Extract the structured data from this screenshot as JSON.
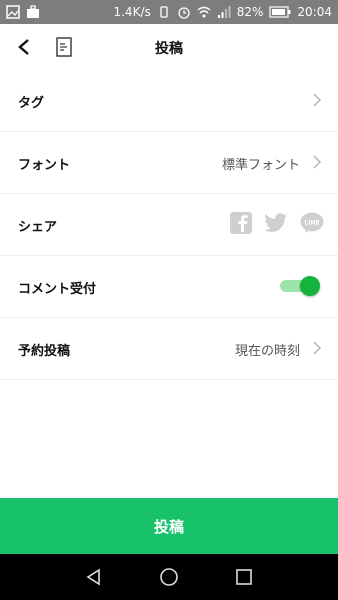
{
  "status_bar": {
    "speed": "1.4K/s",
    "battery": "82%",
    "time": "20:04"
  },
  "header": {
    "title": "投稿"
  },
  "rows": [
    {
      "label": "タグ",
      "value": ""
    },
    {
      "label": "フォント",
      "value": "標準フォント"
    },
    {
      "label": "シェア",
      "value": ""
    },
    {
      "label": "コメント受付",
      "value": ""
    },
    {
      "label": "予約投稿",
      "value": "現在の時刻"
    }
  ],
  "comment_toggle": {
    "on": true
  },
  "share_icons": [
    "facebook-icon",
    "twitter-icon",
    "line-icon"
  ],
  "bottom": {
    "post_label": "投稿"
  },
  "colors": {
    "accent_green": "#17c26b",
    "toggle_knob": "#14b33c",
    "status_bar": "#7d7d7d"
  }
}
